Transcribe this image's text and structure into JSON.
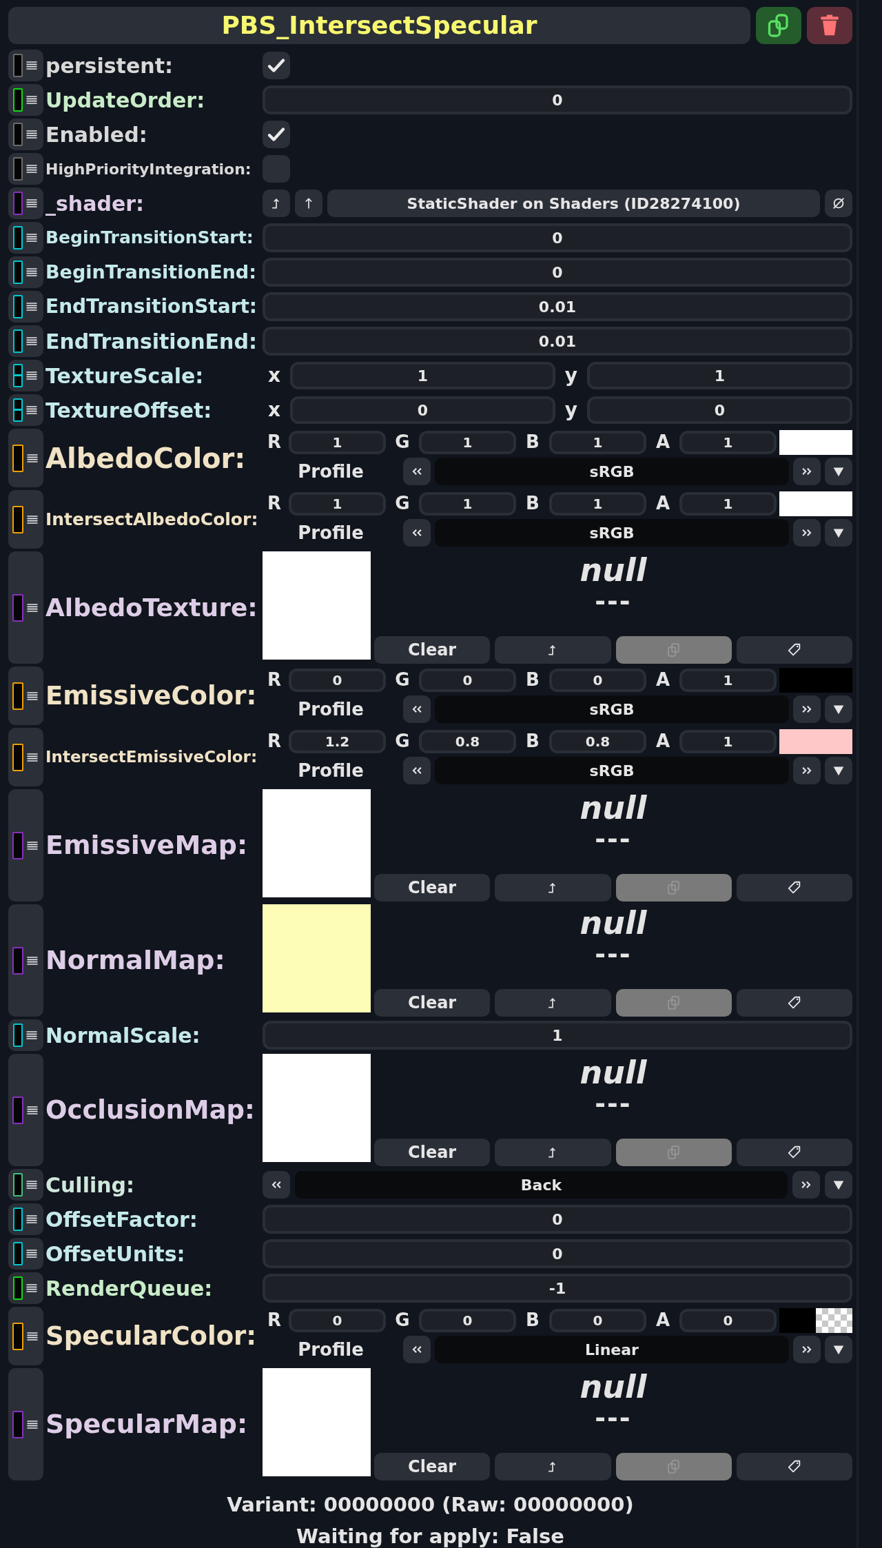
{
  "header": {
    "title": "PBS_IntersectSpecular"
  },
  "fields": [
    {
      "kind": "bool",
      "label": "persistent:",
      "color": "#6b6b6b",
      "checked": true
    },
    {
      "kind": "number",
      "label": "UpdateOrder:",
      "color": "#14d814",
      "value": "0"
    },
    {
      "kind": "bool",
      "label": "Enabled:",
      "color": "#6b6b6b",
      "checked": true
    },
    {
      "kind": "bool",
      "label": "HighPriorityIntegration:",
      "color": "#6b6b6b",
      "checked": false
    },
    {
      "kind": "ref",
      "label": "_shader:",
      "color": "#8a2fc0",
      "value": "StaticShader on Shaders (ID28274100)"
    },
    {
      "kind": "number",
      "label": "BeginTransitionStart:",
      "color": "#00c8d0",
      "value": "0"
    },
    {
      "kind": "number",
      "label": "BeginTransitionEnd:",
      "color": "#00c8d0",
      "value": "0"
    },
    {
      "kind": "number",
      "label": "EndTransitionStart:",
      "color": "#00c8d0",
      "value": "0.01"
    },
    {
      "kind": "number",
      "label": "EndTransitionEnd:",
      "color": "#00c8d0",
      "value": "0.01"
    },
    {
      "kind": "vector",
      "label": "TextureScale:",
      "color": "#00c8d0",
      "components": [
        {
          "axis": "x",
          "value": "1"
        },
        {
          "axis": "y",
          "value": "1"
        }
      ]
    },
    {
      "kind": "vector",
      "label": "TextureOffset:",
      "color": "#00c8d0",
      "components": [
        {
          "axis": "x",
          "value": "0"
        },
        {
          "axis": "y",
          "value": "0"
        }
      ]
    },
    {
      "kind": "color",
      "label": "AlbedoColor:",
      "color": "#f0a000",
      "channels": [
        {
          "channel": "R",
          "value": "1"
        },
        {
          "channel": "G",
          "value": "1"
        },
        {
          "channel": "B",
          "value": "1"
        },
        {
          "channel": "A",
          "value": "1"
        }
      ],
      "swatch": {
        "color": "#ffffff",
        "transparent": false
      },
      "profile_label": "Profile",
      "profile": "sRGB"
    },
    {
      "kind": "color",
      "label": "IntersectAlbedoColor:",
      "color": "#f0a000",
      "channels": [
        {
          "channel": "R",
          "value": "1"
        },
        {
          "channel": "G",
          "value": "1"
        },
        {
          "channel": "B",
          "value": "1"
        },
        {
          "channel": "A",
          "value": "1"
        }
      ],
      "swatch": {
        "color": "#ffffff",
        "transparent": false
      },
      "profile_label": "Profile",
      "profile": "sRGB"
    },
    {
      "kind": "texture",
      "label": "AlbedoTexture:",
      "color": "#8a2fc0",
      "preview": {
        "color": "#ffffff"
      },
      "value": "null",
      "info": "---",
      "clear": "Clear"
    },
    {
      "kind": "color",
      "label": "EmissiveColor:",
      "color": "#f0a000",
      "channels": [
        {
          "channel": "R",
          "value": "0"
        },
        {
          "channel": "G",
          "value": "0"
        },
        {
          "channel": "B",
          "value": "0"
        },
        {
          "channel": "A",
          "value": "1"
        }
      ],
      "swatch": {
        "color": "#000000",
        "transparent": false
      },
      "profile_label": "Profile",
      "profile": "sRGB"
    },
    {
      "kind": "color",
      "label": "IntersectEmissiveColor:",
      "color": "#f0a000",
      "channels": [
        {
          "channel": "R",
          "value": "1.2"
        },
        {
          "channel": "G",
          "value": "0.8"
        },
        {
          "channel": "B",
          "value": "0.8"
        },
        {
          "channel": "A",
          "value": "1"
        }
      ],
      "swatch": {
        "color": "#ffc8c8",
        "transparent": false
      },
      "profile_label": "Profile",
      "profile": "sRGB"
    },
    {
      "kind": "texture",
      "label": "EmissiveMap:",
      "color": "#8a2fc0",
      "preview": {
        "color": "#ffffff"
      },
      "value": "null",
      "info": "---",
      "clear": "Clear"
    },
    {
      "kind": "texture",
      "label": "NormalMap:",
      "color": "#8a2fc0",
      "preview": {
        "color": "#fdfdb8"
      },
      "value": "null",
      "info": "---",
      "clear": "Clear"
    },
    {
      "kind": "number",
      "label": "NormalScale:",
      "color": "#00c8d0",
      "value": "1"
    },
    {
      "kind": "texture",
      "label": "OcclusionMap:",
      "color": "#8a2fc0",
      "preview": {
        "color": "#ffffff"
      },
      "value": "null",
      "info": "---",
      "clear": "Clear"
    },
    {
      "kind": "enum",
      "label": "Culling:",
      "color": "#40c080",
      "value": "Back"
    },
    {
      "kind": "number",
      "label": "OffsetFactor:",
      "color": "#00c8d0",
      "value": "0"
    },
    {
      "kind": "number",
      "label": "OffsetUnits:",
      "color": "#00c8d0",
      "value": "0"
    },
    {
      "kind": "number",
      "label": "RenderQueue:",
      "color": "#14d814",
      "value": "-1"
    },
    {
      "kind": "color",
      "label": "SpecularColor:",
      "color": "#f0a000",
      "channels": [
        {
          "channel": "R",
          "value": "0"
        },
        {
          "channel": "G",
          "value": "0"
        },
        {
          "channel": "B",
          "value": "0"
        },
        {
          "channel": "A",
          "value": "0"
        }
      ],
      "swatch": {
        "color": "#000000",
        "transparent": true
      },
      "profile_label": "Profile",
      "profile": "Linear"
    },
    {
      "kind": "texture",
      "label": "SpecularMap:",
      "color": "#8a2fc0",
      "preview": {
        "color": "#ffffff"
      },
      "value": "null",
      "info": "---",
      "clear": "Clear"
    }
  ],
  "footer": [
    "Variant: 00000000 (Raw: 00000000)",
    "Waiting for apply: False"
  ]
}
